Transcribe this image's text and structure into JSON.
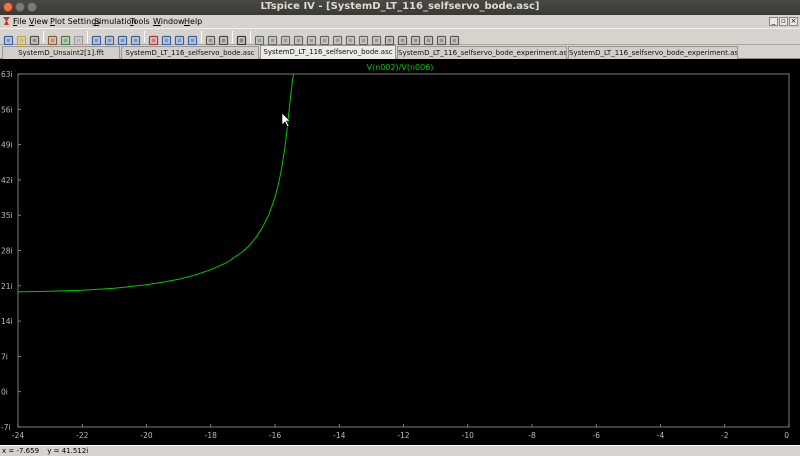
{
  "window": {
    "title": "LTspice IV - [SystemD_LT_116_selfservo_bode.asc]"
  },
  "menu": {
    "items": [
      "File",
      "View",
      "Plot Settings",
      "Simulation",
      "Tools",
      "Window",
      "Help"
    ]
  },
  "toolbar": {
    "icons": [
      "new-schematic-icon",
      "open-icon",
      "save-icon",
      "control-panel-icon",
      "run-icon",
      "halt-icon",
      "zoom-in-icon",
      "zoom-pan-icon",
      "zoom-out-icon",
      "zoom-fit-icon",
      "autorange-icon",
      "tile-horizontal-icon",
      "tile-vertical-icon",
      "cascade-icon",
      "close-window-icon",
      "print-icon",
      "find-icon",
      "wire-icon",
      "ground-icon",
      "label-icon",
      "resistor-icon",
      "capacitor-icon",
      "inductor-icon",
      "diode-icon",
      "component-icon",
      "move-icon",
      "drag-icon",
      "undo-icon",
      "redo-icon",
      "rotate-icon",
      "mirror-icon",
      "text-icon",
      "spice-directive-icon"
    ]
  },
  "tabs": [
    {
      "label": "SystemD_Unsaint2[1].fft",
      "active": false
    },
    {
      "label": "SystemD_LT_116_selfservo_bode.asc",
      "active": false
    },
    {
      "label": "SystemD_LT_116_selfservo_bode.asc",
      "active": true
    },
    {
      "label": "SystemD_LT_116_selfservo_bode_experiment.asc",
      "active": false
    },
    {
      "label": "SystemD_LT_116_selfservo_bode_experiment.asc",
      "active": false
    }
  ],
  "chart_data": {
    "type": "line",
    "trace_label": "V(n002)/V(n006)",
    "trace_color": "#00c800",
    "background": "#000000",
    "xlim": [
      -24,
      0
    ],
    "ylim": [
      -7,
      63
    ],
    "x_ticks": [
      "-24",
      "-22",
      "-20",
      "-18",
      "-16",
      "-14",
      "-12",
      "-10",
      "-8",
      "-6",
      "-4",
      "-2",
      "0"
    ],
    "y_ticks": [
      "63i",
      "56i",
      "49i",
      "42i",
      "35i",
      "28i",
      "21i",
      "14i",
      "7i",
      "0i",
      "-7i"
    ],
    "series": [
      {
        "name": "V(n002)/V(n006)",
        "x": [
          -24,
          -23,
          -22,
          -21,
          -20,
          -19.5,
          -19,
          -18.5,
          -18,
          -17.5,
          -17,
          -16.8,
          -16.6,
          -16.4,
          -16.2,
          -16.0,
          -15.9,
          -15.8,
          -15.7,
          -15.65,
          -15.6,
          -15.55,
          -15.5,
          -15.45,
          -15.42
        ],
        "y": [
          19.8,
          19.9,
          20.1,
          20.5,
          21.2,
          21.7,
          22.3,
          23.1,
          24.2,
          25.6,
          27.8,
          29.0,
          30.5,
          32.5,
          35.0,
          38.5,
          41.0,
          44.0,
          48.0,
          50.5,
          53.5,
          56.5,
          59.5,
          62.0,
          63.0
        ]
      }
    ]
  },
  "status": {
    "x_readout": "x = -7.659",
    "y_readout": "y = 41.512i"
  },
  "cursor": {
    "name": "mouse-pointer"
  }
}
